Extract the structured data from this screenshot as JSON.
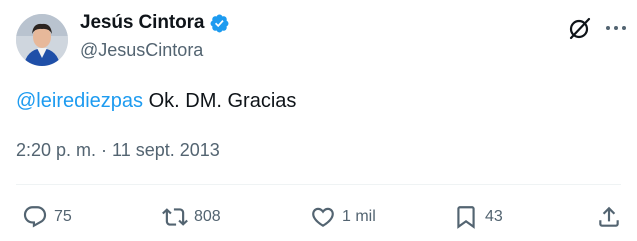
{
  "author": {
    "display_name": "Jesús Cintora",
    "handle": "@JesusCintora",
    "verified": true
  },
  "tweet": {
    "mention": "@leirediezpas",
    "text": " Ok. DM. Gracias",
    "time": "2:20 p. m.",
    "separator": " · ",
    "date": "11 sept. 2013"
  },
  "actions": {
    "replies": "75",
    "retweets": "808",
    "likes": "1 mil",
    "bookmarks": "43"
  },
  "icons": {
    "grok": "grok-icon",
    "more": "more-icon",
    "reply": "reply-icon",
    "retweet": "retweet-icon",
    "like": "heart-icon",
    "bookmark": "bookmark-icon",
    "share": "share-icon"
  },
  "colors": {
    "accent": "#1d9bf0",
    "text": "#0f1419",
    "secondary": "#536471",
    "divider": "#eff3f4"
  }
}
